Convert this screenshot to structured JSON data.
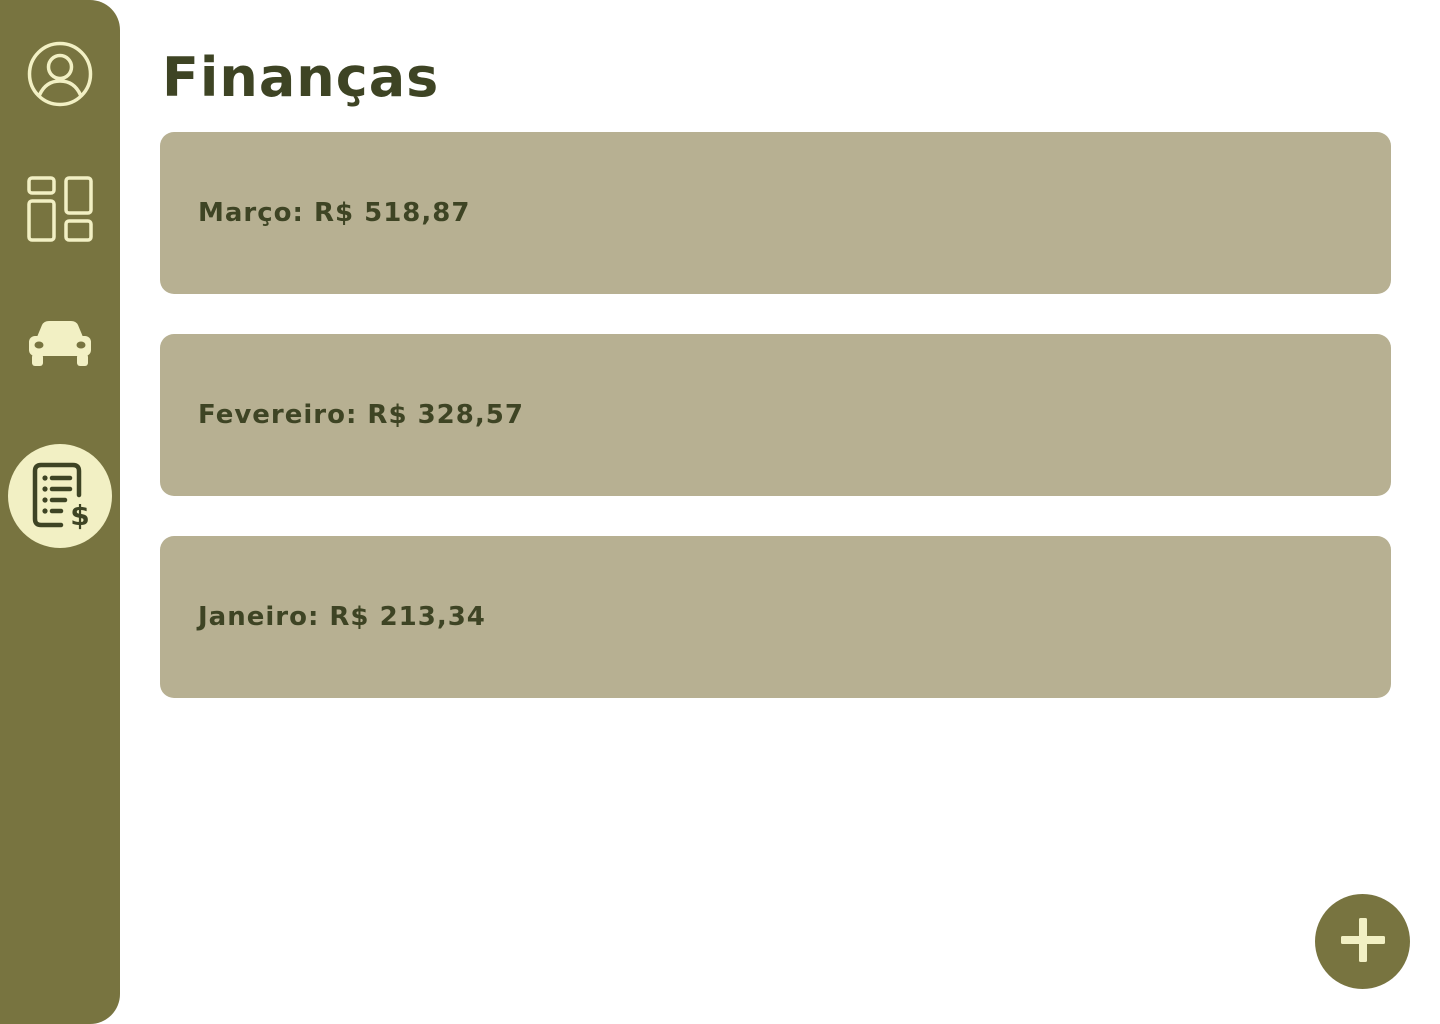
{
  "page": {
    "title": "Finanças"
  },
  "sidebar": {
    "items": [
      {
        "icon": "user-profile-icon",
        "active": false
      },
      {
        "icon": "dashboard-icon",
        "active": false
      },
      {
        "icon": "car-icon",
        "active": false
      },
      {
        "icon": "finance-document-icon",
        "active": true
      }
    ]
  },
  "entries": [
    {
      "month": "Março",
      "currency": "R$",
      "amount": "518,87",
      "text": "Março: R$ 518,87"
    },
    {
      "month": "Fevereiro",
      "currency": "R$",
      "amount": "328,57",
      "text": "Fevereiro: R$ 328,57"
    },
    {
      "month": "Janeiro",
      "currency": "R$",
      "amount": "213,34",
      "text": "Janeiro: R$ 213,34"
    }
  ],
  "fab": {
    "icon": "plus-icon"
  },
  "colors": {
    "sidebar": "#787440",
    "accent_light": "#f2f0c4",
    "card": "#b7b092",
    "text_dark": "#3e4424"
  }
}
